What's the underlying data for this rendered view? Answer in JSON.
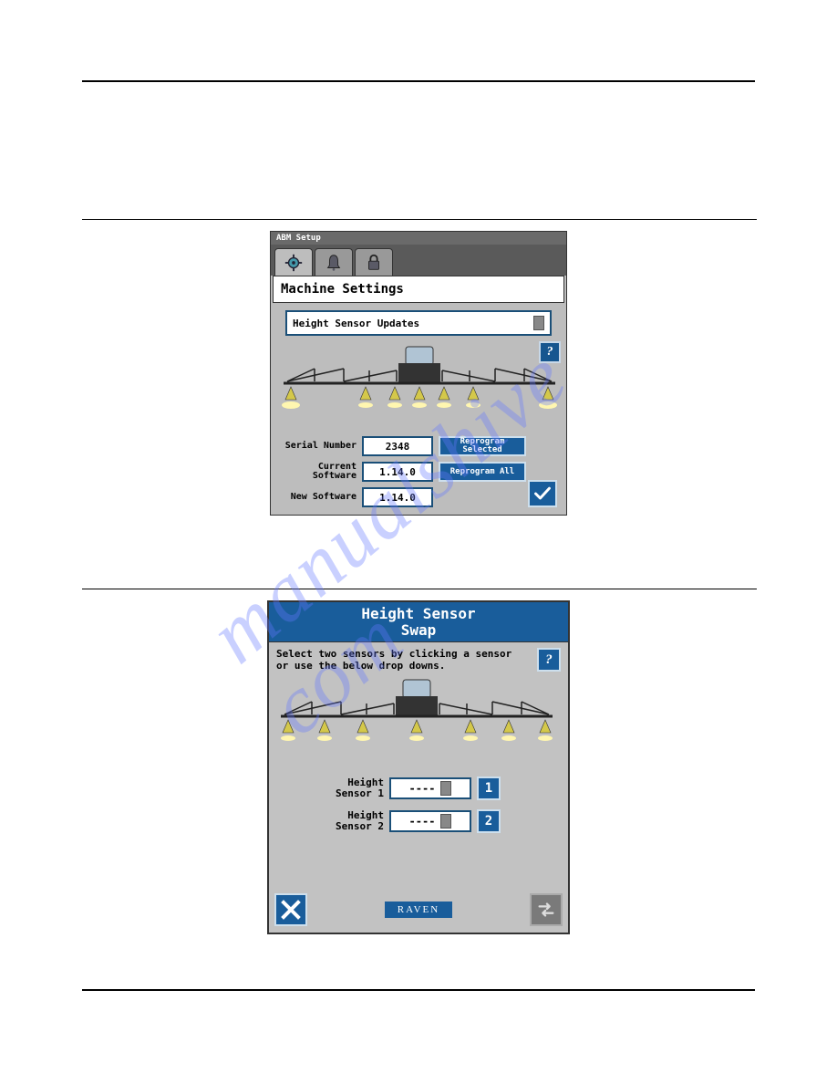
{
  "watermark": "manualshive com",
  "abm": {
    "titlebar": "ABM Setup",
    "header": "Machine Settings",
    "select_label": "Height Sensor Updates",
    "serial_label": "Serial Number",
    "serial_value": "2348",
    "current_sw_label": "Current Software",
    "current_sw_value": "1.14.0",
    "new_sw_label": "New Software",
    "new_sw_value": "1.14.0",
    "reprogram_selected": "Reprogram Selected",
    "reprogram_all": "Reprogram All",
    "help": "?"
  },
  "hss": {
    "title_line1": "Height Sensor",
    "title_line2": "Swap",
    "instructions": "Select two sensors by clicking a sensor or use the below drop downs.",
    "help": "?",
    "sensor1_label": "Height Sensor 1",
    "sensor1_value": "----",
    "sensor1_num": "1",
    "sensor2_label": "Height Sensor 2",
    "sensor2_value": "----",
    "sensor2_num": "2",
    "logo": "RAVEN"
  },
  "page_label_left": "",
  "page_label_right": ""
}
